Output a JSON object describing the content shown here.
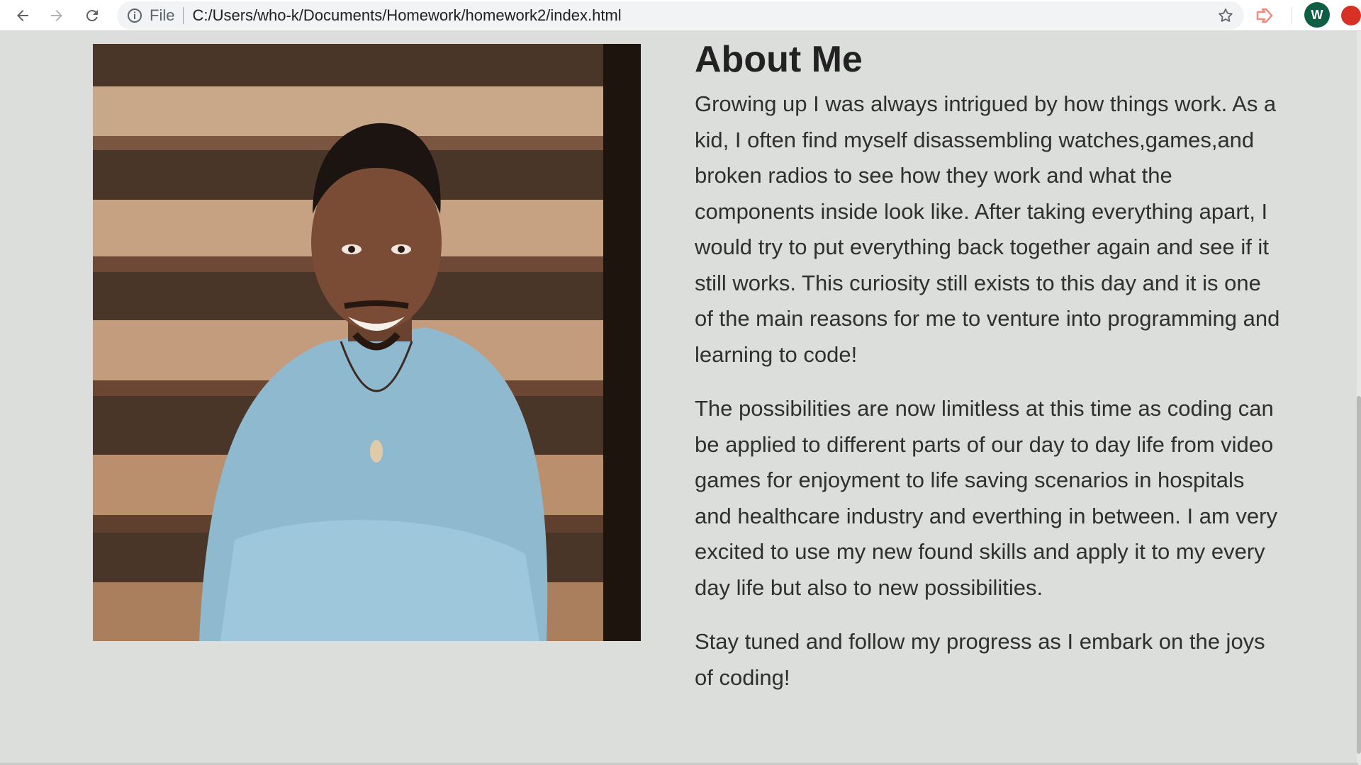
{
  "browser": {
    "file_label": "File",
    "url": "C:/Users/who-k/Documents/Homework/homework2/index.html",
    "profile_initial": "W",
    "icons": [
      "back-arrow-icon",
      "forward-arrow-icon",
      "reload-icon",
      "info-icon",
      "star-icon",
      "extension-icon",
      "update-icon"
    ]
  },
  "page": {
    "photo_alt": "Portrait photo",
    "title": "About Me",
    "paragraphs": [
      "Growing up I was always intrigued by how things work. As a kid, I often find myself disassembling watches,games,and broken radios to see how they work and what the components inside look like. After taking everything apart, I would try to put everything back together again and see if it still works. This curiosity still exists to this day and it is one of the main reasons for me to venture into programming and learning to code!",
      "The possibilities are now limitless at this time as coding can be applied to different parts of our day to day life from video games for enjoyment to life saving scenarios in hospitals and healthcare industry and everthing in between. I am very excited to use my new found skills and apply it to my every day life but also to new possibilities.",
      "Stay tuned and follow my progress as I embark on the joys of coding!"
    ]
  },
  "colors": {
    "page_background": "#dcdedb",
    "text": "#2f2f2f",
    "avatar": "#0d5e43",
    "update_badge": "#d93025"
  }
}
